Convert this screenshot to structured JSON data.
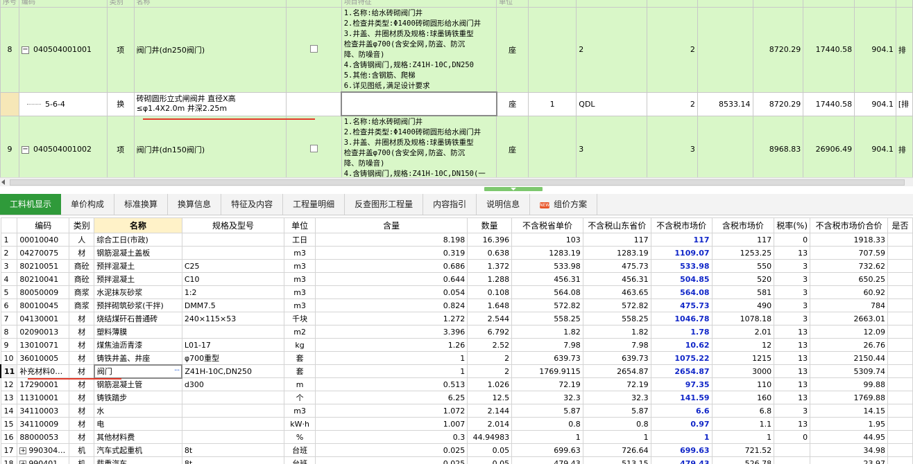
{
  "top_grid": {
    "header_fragments": [
      "序号",
      "编码",
      "类别",
      "名称",
      "项目特征",
      "单位"
    ],
    "rows": [
      {
        "kind": "item",
        "index": "8",
        "code": "040504001001",
        "type": "项",
        "name": "阀门井(dn250阀门)",
        "features": [
          "1.名称:给水砖砌阀门井",
          "2.检查井类型:Φ1400砖砌圆形给水阀门井",
          "3.井盖、井圈材质及规格:球墨铸铁重型",
          "检查井盖φ700(含安全网,防盗、防沉",
          "降、防噪音)",
          "4.含铸钢阀门,规格:Z41H-10C,DN250",
          "5.其他:含钢筋、爬梯",
          "6.详见图纸,满足设计要求"
        ],
        "unit": "座",
        "qty_expr": "",
        "qty_code": "2",
        "quantity": "2",
        "unit_price": "",
        "composite_price": "8720.29",
        "total": "17440.58",
        "extra": "904.1",
        "tail": "排"
      },
      {
        "kind": "sub",
        "index": "",
        "code": "5-6-4",
        "type": "换",
        "name_lines": [
          "砖砌圆形立式闸阀井 直径X高",
          "≤φ1.4X2.0m 井深2.25m"
        ],
        "features": [],
        "unit": "座",
        "qty_expr": "1",
        "qty_code": "QDL",
        "quantity": "2",
        "unit_price": "8533.14",
        "composite_price": "8720.29",
        "total": "17440.58",
        "extra": "904.1",
        "tail": "[排"
      },
      {
        "kind": "item",
        "index": "9",
        "code": "040504001002",
        "type": "项",
        "name": "阀门井(dn150阀门)",
        "features": [
          "1.名称:给水砖砌阀门井",
          "2.检查井类型:Φ1400砖砌圆形给水阀门井",
          "3.井盖、井圈材质及规格:球墨铸铁重型",
          "检查井盖φ700(含安全网,防盗、防沉",
          "降、防噪音)",
          "4.含铸钢阀门,规格:Z41H-10C,DN150(一"
        ],
        "unit": "座",
        "qty_expr": "",
        "qty_code": "3",
        "quantity": "3",
        "unit_price": "",
        "composite_price": "8968.83",
        "total": "26906.49",
        "extra": "904.1",
        "tail": "排"
      }
    ]
  },
  "tabs": [
    {
      "label": "工料机显示",
      "active": true
    },
    {
      "label": "单价构成"
    },
    {
      "label": "标准换算"
    },
    {
      "label": "换算信息"
    },
    {
      "label": "特征及内容"
    },
    {
      "label": "工程量明细"
    },
    {
      "label": "反查图形工程量"
    },
    {
      "label": "内容指引"
    },
    {
      "label": "说明信息"
    },
    {
      "label": "组价方案",
      "badge": "NEW"
    }
  ],
  "bottom_grid": {
    "columns": [
      "编码",
      "类别",
      "名称",
      "规格及型号",
      "单位",
      "含量",
      "数量",
      "不含税省单价",
      "不含税山东省价",
      "不含税市场价",
      "含税市场价",
      "税率(%)",
      "不含税市场价合价",
      "是否"
    ],
    "rows": [
      [
        "1",
        "00010040",
        "人",
        "综合工日(市政)",
        "",
        "工日",
        "8.198",
        "16.396",
        "103",
        "117",
        "117",
        "117",
        "0",
        "1918.33"
      ],
      [
        "2",
        "04270075",
        "材",
        "钢筋混凝土盖板",
        "",
        "m3",
        "0.319",
        "0.638",
        "1283.19",
        "1283.19",
        "1109.07",
        "1253.25",
        "13",
        "707.59"
      ],
      [
        "3",
        "80210051",
        "商砼",
        "预拌混凝土",
        "C25",
        "m3",
        "0.686",
        "1.372",
        "533.98",
        "475.73",
        "533.98",
        "550",
        "3",
        "732.62"
      ],
      [
        "4",
        "80210041",
        "商砼",
        "预拌混凝土",
        "C10",
        "m3",
        "0.644",
        "1.288",
        "456.31",
        "456.31",
        "504.85",
        "520",
        "3",
        "650.25"
      ],
      [
        "5",
        "80050009",
        "商浆",
        "水泥抹灰砂浆",
        "1:2",
        "m3",
        "0.054",
        "0.108",
        "564.08",
        "463.65",
        "564.08",
        "581",
        "3",
        "60.92"
      ],
      [
        "6",
        "80010045",
        "商浆",
        "预拌砌筑砂浆(干拌)",
        "DMM7.5",
        "m3",
        "0.824",
        "1.648",
        "572.82",
        "572.82",
        "475.73",
        "490",
        "3",
        "784"
      ],
      [
        "7",
        "04130001",
        "材",
        "烧结煤矸石普通砖",
        "240×115×53",
        "千块",
        "1.272",
        "2.544",
        "558.25",
        "558.25",
        "1046.78",
        "1078.18",
        "3",
        "2663.01"
      ],
      [
        "8",
        "02090013",
        "材",
        "塑料薄膜",
        "",
        "m2",
        "3.396",
        "6.792",
        "1.82",
        "1.82",
        "1.78",
        "2.01",
        "13",
        "12.09"
      ],
      [
        "9",
        "13010071",
        "材",
        "煤焦油沥青漆",
        "L01-17",
        "kg",
        "1.26",
        "2.52",
        "7.98",
        "7.98",
        "10.62",
        "12",
        "13",
        "26.76"
      ],
      [
        "10",
        "36010005",
        "材",
        "铸铁井盖、井座",
        "φ700重型",
        "套",
        "1",
        "2",
        "639.73",
        "639.73",
        "1075.22",
        "1215",
        "13",
        "2150.44"
      ],
      [
        "11",
        "补充材料0…",
        "材",
        "阀门",
        "Z41H-10C,DN250",
        "套",
        "1",
        "2",
        "1769.9115",
        "2654.87",
        "2654.87",
        "3000",
        "13",
        "5309.74"
      ],
      [
        "12",
        "17290001",
        "材",
        "钢筋混凝土管",
        "d300",
        "m",
        "0.513",
        "1.026",
        "72.19",
        "72.19",
        "97.35",
        "110",
        "13",
        "99.88"
      ],
      [
        "13",
        "11310001",
        "材",
        "铸铁踏步",
        "",
        "个",
        "6.25",
        "12.5",
        "32.3",
        "32.3",
        "141.59",
        "160",
        "13",
        "1769.88"
      ],
      [
        "14",
        "34110003",
        "材",
        "水",
        "",
        "m3",
        "1.072",
        "2.144",
        "5.87",
        "5.87",
        "6.6",
        "6.8",
        "3",
        "14.15"
      ],
      [
        "15",
        "34110009",
        "材",
        "电",
        "",
        "kW·h",
        "1.007",
        "2.014",
        "0.8",
        "0.8",
        "0.97",
        "1.1",
        "13",
        "1.95"
      ],
      [
        "16",
        "88000053",
        "材",
        "其他材料费",
        "",
        "%",
        "0.3",
        "44.94983",
        "1",
        "1",
        "1",
        "1",
        "0",
        "44.95"
      ],
      [
        "17",
        "990304…",
        "机",
        "汽车式起重机",
        "8t",
        "台班",
        "0.025",
        "0.05",
        "699.63",
        "726.64",
        "699.63",
        "721.52",
        "",
        "34.98"
      ],
      [
        "18",
        "990401…",
        "机",
        "载重汽车",
        "8t",
        "台班",
        "0.025",
        "0.05",
        "479.43",
        "513.15",
        "479.43",
        "526.78",
        "",
        "23.97"
      ]
    ],
    "blue_column_index": 10,
    "current_row": "11"
  }
}
